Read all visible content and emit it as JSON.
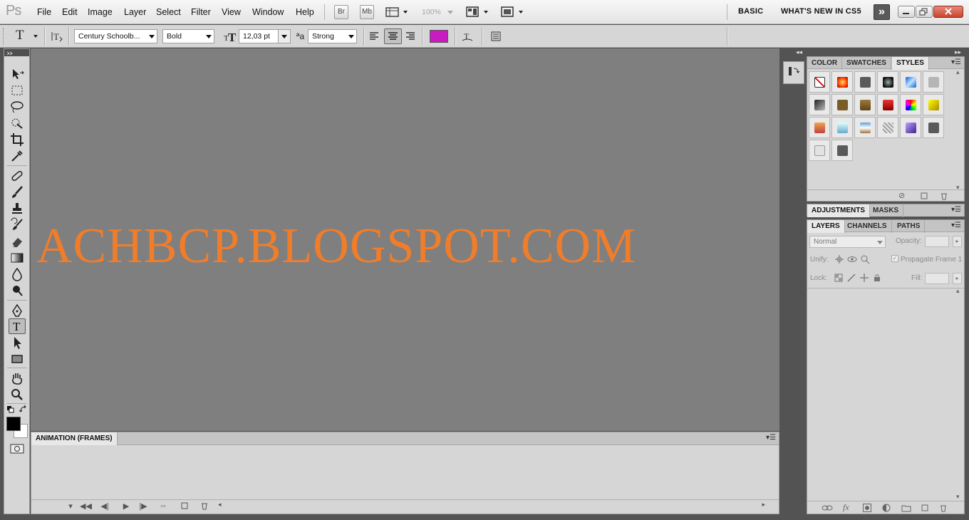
{
  "app": {
    "logo": "Ps"
  },
  "menu": [
    "File",
    "Edit",
    "Image",
    "Layer",
    "Select",
    "Filter",
    "View",
    "Window",
    "Help"
  ],
  "appbar": {
    "bridge": "Br",
    "minibridge": "Mb",
    "zoom": "100%"
  },
  "workspaces": {
    "basic": "BASIC",
    "whats_new": "WHAT'S NEW IN CS5"
  },
  "options": {
    "font_family": "Century Schoolb...",
    "font_style": "Bold",
    "font_size": "12,03 pt",
    "aa_label": "ªa",
    "antialias": "Strong",
    "text_color": "#c81bc0"
  },
  "canvas": {
    "text": "ACHBCP.BLOGSPOT.COM",
    "text_color": "#f07d2a",
    "bg": "#7f7f7f"
  },
  "animation": {
    "tab": "ANIMATION (FRAMES)"
  },
  "panels": {
    "color_group": {
      "tabs": [
        "COLOR",
        "SWATCHES",
        "STYLES"
      ],
      "active": "STYLES"
    },
    "adjust_group": {
      "tabs": [
        "ADJUSTMENTS",
        "MASKS"
      ]
    },
    "layers_group": {
      "tabs": [
        "LAYERS",
        "CHANNELS",
        "PATHS"
      ],
      "active": "LAYERS"
    },
    "layers": {
      "blend_mode": "Normal",
      "opacity_label": "Opacity:",
      "unify_label": "Unify:",
      "propagate_label": "Propagate Frame 1",
      "lock_label": "Lock:",
      "fill_label": "Fill:"
    }
  }
}
